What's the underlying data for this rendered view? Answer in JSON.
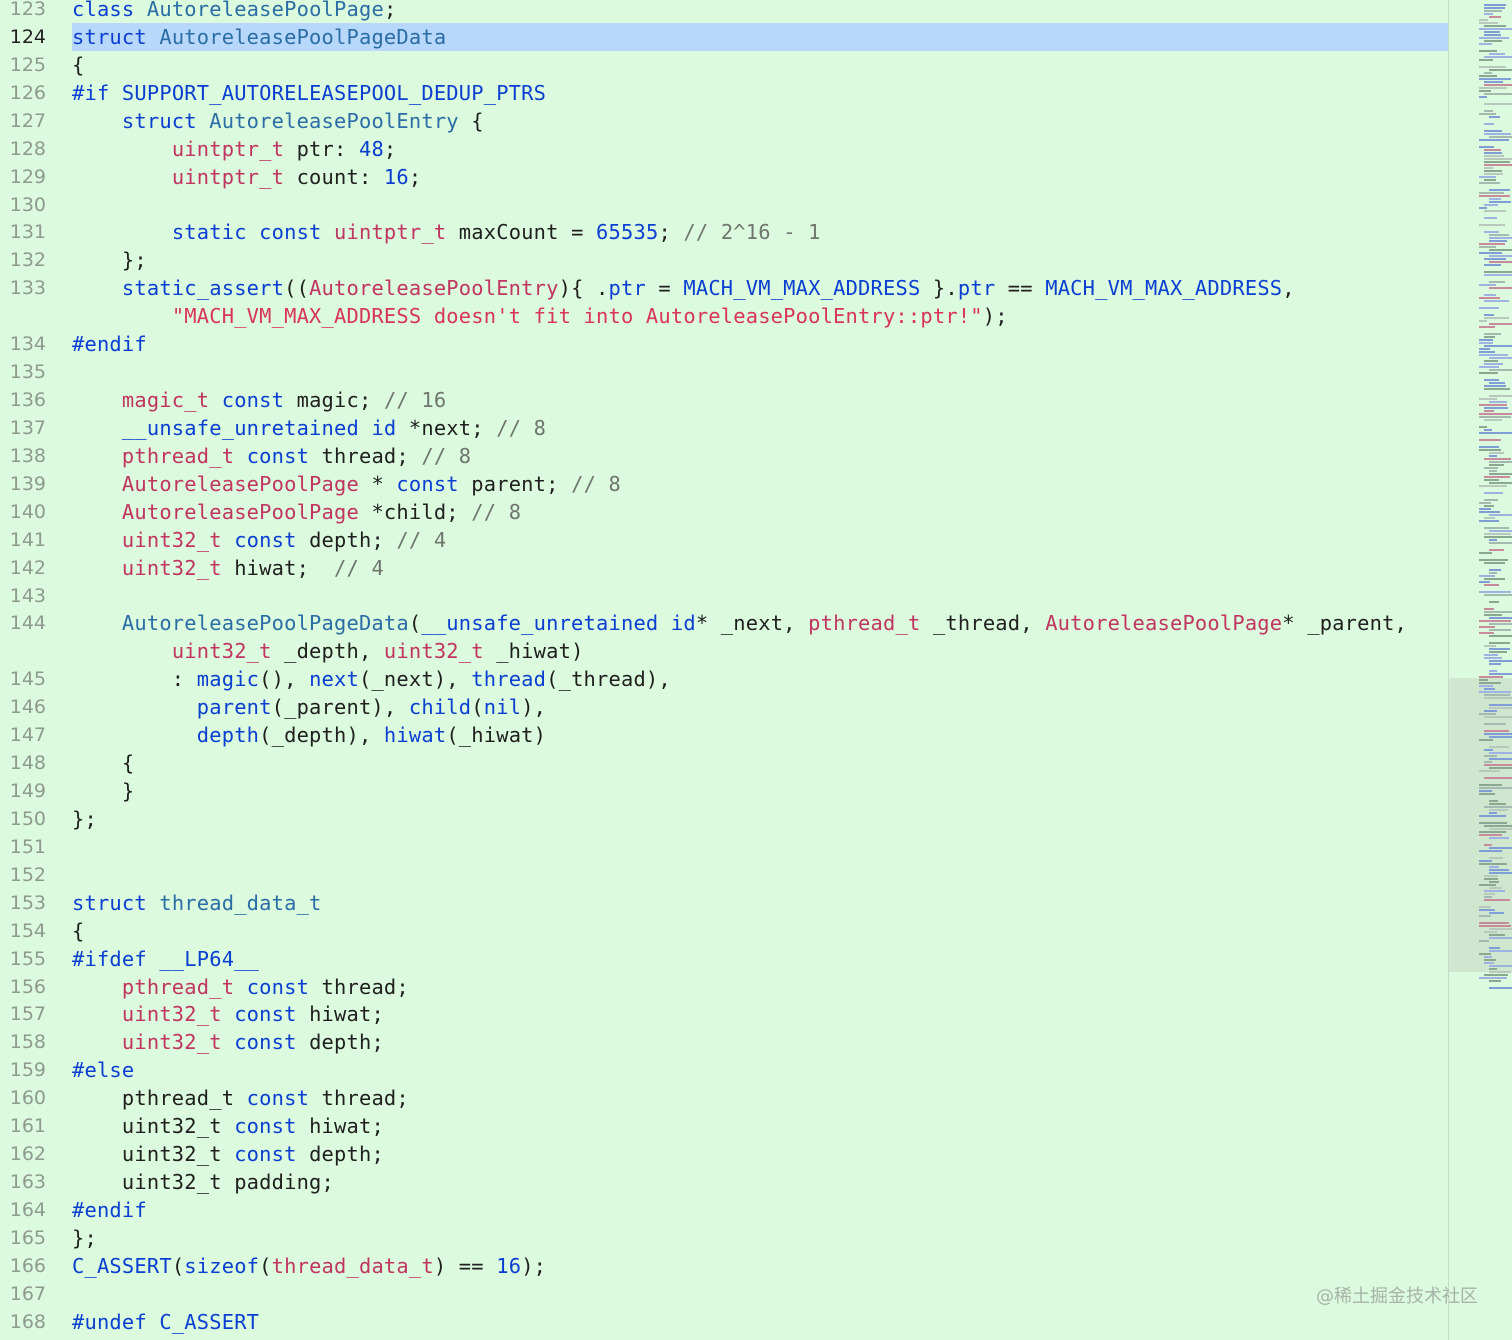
{
  "editor": {
    "current_line": 124,
    "lines": [
      {
        "num": "123",
        "tokens": [
          [
            "keyword",
            "class"
          ],
          [
            "plain",
            " "
          ],
          [
            "class",
            "AutoreleasePoolPage"
          ],
          [
            "plain",
            ";"
          ]
        ]
      },
      {
        "num": "124",
        "tokens": [
          [
            "keyword",
            "struct"
          ],
          [
            "plain",
            " "
          ],
          [
            "class",
            "AutoreleasePoolPageData"
          ]
        ]
      },
      {
        "num": "125",
        "tokens": [
          [
            "plain",
            "{"
          ]
        ]
      },
      {
        "num": "126",
        "tokens": [
          [
            "preproc",
            "#if"
          ],
          [
            "plain",
            " "
          ],
          [
            "macro",
            "SUPPORT_AUTORELEASEPOOL_DEDUP_PTRS"
          ]
        ]
      },
      {
        "num": "127",
        "tokens": [
          [
            "plain",
            "    "
          ],
          [
            "keyword",
            "struct"
          ],
          [
            "plain",
            " "
          ],
          [
            "class",
            "AutoreleasePoolEntry"
          ],
          [
            "plain",
            " {"
          ]
        ]
      },
      {
        "num": "128",
        "tokens": [
          [
            "plain",
            "        "
          ],
          [
            "type",
            "uintptr_t"
          ],
          [
            "plain",
            " ptr: "
          ],
          [
            "number",
            "48"
          ],
          [
            "plain",
            ";"
          ]
        ]
      },
      {
        "num": "129",
        "tokens": [
          [
            "plain",
            "        "
          ],
          [
            "type",
            "uintptr_t"
          ],
          [
            "plain",
            " count: "
          ],
          [
            "number",
            "16"
          ],
          [
            "plain",
            ";"
          ]
        ]
      },
      {
        "num": "130",
        "tokens": []
      },
      {
        "num": "131",
        "tokens": [
          [
            "plain",
            "        "
          ],
          [
            "keyword",
            "static"
          ],
          [
            "plain",
            " "
          ],
          [
            "keyword",
            "const"
          ],
          [
            "plain",
            " "
          ],
          [
            "type",
            "uintptr_t"
          ],
          [
            "plain",
            " maxCount = "
          ],
          [
            "number",
            "65535"
          ],
          [
            "plain",
            "; "
          ],
          [
            "comment",
            "// 2^16 - 1"
          ]
        ]
      },
      {
        "num": "132",
        "tokens": [
          [
            "plain",
            "    };"
          ]
        ]
      },
      {
        "num": "133",
        "tokens": [
          [
            "plain",
            "    "
          ],
          [
            "func",
            "static_assert"
          ],
          [
            "plain",
            "(("
          ],
          [
            "type",
            "AutoreleasePoolEntry"
          ],
          [
            "plain",
            "){ ."
          ],
          [
            "func",
            "ptr"
          ],
          [
            "plain",
            " = "
          ],
          [
            "macro",
            "MACH_VM_MAX_ADDRESS"
          ],
          [
            "plain",
            " }."
          ],
          [
            "func",
            "ptr"
          ],
          [
            "plain",
            " == "
          ],
          [
            "macro",
            "MACH_VM_MAX_ADDRESS"
          ],
          [
            "plain",
            ","
          ]
        ]
      },
      {
        "num": "",
        "tokens": [
          [
            "plain",
            "        "
          ],
          [
            "string",
            "\"MACH_VM_MAX_ADDRESS doesn't fit into AutoreleasePoolEntry::ptr!\""
          ],
          [
            "plain",
            ");"
          ]
        ]
      },
      {
        "num": "134",
        "tokens": [
          [
            "preproc",
            "#endif"
          ]
        ]
      },
      {
        "num": "135",
        "tokens": []
      },
      {
        "num": "136",
        "tokens": [
          [
            "plain",
            "    "
          ],
          [
            "type",
            "magic_t"
          ],
          [
            "plain",
            " "
          ],
          [
            "keyword",
            "const"
          ],
          [
            "plain",
            " magic; "
          ],
          [
            "comment",
            "// 16"
          ]
        ]
      },
      {
        "num": "137",
        "tokens": [
          [
            "plain",
            "    "
          ],
          [
            "keyword",
            "__unsafe_unretained"
          ],
          [
            "plain",
            " "
          ],
          [
            "keyword",
            "id"
          ],
          [
            "plain",
            " *next; "
          ],
          [
            "comment",
            "// 8"
          ]
        ]
      },
      {
        "num": "138",
        "tokens": [
          [
            "plain",
            "    "
          ],
          [
            "type",
            "pthread_t"
          ],
          [
            "plain",
            " "
          ],
          [
            "keyword",
            "const"
          ],
          [
            "plain",
            " thread; "
          ],
          [
            "comment",
            "// 8"
          ]
        ]
      },
      {
        "num": "139",
        "tokens": [
          [
            "plain",
            "    "
          ],
          [
            "type",
            "AutoreleasePoolPage"
          ],
          [
            "plain",
            " * "
          ],
          [
            "keyword",
            "const"
          ],
          [
            "plain",
            " parent; "
          ],
          [
            "comment",
            "// 8"
          ]
        ]
      },
      {
        "num": "140",
        "tokens": [
          [
            "plain",
            "    "
          ],
          [
            "type",
            "AutoreleasePoolPage"
          ],
          [
            "plain",
            " *child; "
          ],
          [
            "comment",
            "// 8"
          ]
        ]
      },
      {
        "num": "141",
        "tokens": [
          [
            "plain",
            "    "
          ],
          [
            "type",
            "uint32_t"
          ],
          [
            "plain",
            " "
          ],
          [
            "keyword",
            "const"
          ],
          [
            "plain",
            " depth; "
          ],
          [
            "comment",
            "// 4"
          ]
        ]
      },
      {
        "num": "142",
        "tokens": [
          [
            "plain",
            "    "
          ],
          [
            "type",
            "uint32_t"
          ],
          [
            "plain",
            " hiwat;  "
          ],
          [
            "comment",
            "// 4"
          ]
        ]
      },
      {
        "num": "143",
        "tokens": []
      },
      {
        "num": "144",
        "tokens": [
          [
            "plain",
            "    "
          ],
          [
            "class",
            "AutoreleasePoolPageData"
          ],
          [
            "plain",
            "("
          ],
          [
            "keyword",
            "__unsafe_unretained"
          ],
          [
            "plain",
            " "
          ],
          [
            "keyword",
            "id"
          ],
          [
            "plain",
            "* _next, "
          ],
          [
            "type",
            "pthread_t"
          ],
          [
            "plain",
            " _thread, "
          ],
          [
            "type",
            "AutoreleasePoolPage"
          ],
          [
            "plain",
            "* _parent,"
          ]
        ]
      },
      {
        "num": "",
        "tokens": [
          [
            "plain",
            "        "
          ],
          [
            "type",
            "uint32_t"
          ],
          [
            "plain",
            " _depth, "
          ],
          [
            "type",
            "uint32_t"
          ],
          [
            "plain",
            " _hiwat)"
          ]
        ]
      },
      {
        "num": "145",
        "tokens": [
          [
            "plain",
            "        : "
          ],
          [
            "func",
            "magic"
          ],
          [
            "plain",
            "(), "
          ],
          [
            "func",
            "next"
          ],
          [
            "plain",
            "(_next), "
          ],
          [
            "func",
            "thread"
          ],
          [
            "plain",
            "(_thread),"
          ]
        ]
      },
      {
        "num": "146",
        "tokens": [
          [
            "plain",
            "          "
          ],
          [
            "func",
            "parent"
          ],
          [
            "plain",
            "(_parent), "
          ],
          [
            "func",
            "child"
          ],
          [
            "plain",
            "("
          ],
          [
            "keyword",
            "nil"
          ],
          [
            "plain",
            "),"
          ]
        ]
      },
      {
        "num": "147",
        "tokens": [
          [
            "plain",
            "          "
          ],
          [
            "func",
            "depth"
          ],
          [
            "plain",
            "(_depth), "
          ],
          [
            "func",
            "hiwat"
          ],
          [
            "plain",
            "(_hiwat)"
          ]
        ]
      },
      {
        "num": "148",
        "tokens": [
          [
            "plain",
            "    {"
          ]
        ]
      },
      {
        "num": "149",
        "tokens": [
          [
            "plain",
            "    }"
          ]
        ]
      },
      {
        "num": "150",
        "tokens": [
          [
            "plain",
            "};"
          ]
        ]
      },
      {
        "num": "151",
        "tokens": []
      },
      {
        "num": "152",
        "tokens": []
      },
      {
        "num": "153",
        "tokens": [
          [
            "keyword",
            "struct"
          ],
          [
            "plain",
            " "
          ],
          [
            "class",
            "thread_data_t"
          ]
        ]
      },
      {
        "num": "154",
        "tokens": [
          [
            "plain",
            "{"
          ]
        ]
      },
      {
        "num": "155",
        "tokens": [
          [
            "preproc",
            "#ifdef"
          ],
          [
            "plain",
            " "
          ],
          [
            "macro",
            "__LP64__"
          ]
        ]
      },
      {
        "num": "156",
        "tokens": [
          [
            "plain",
            "    "
          ],
          [
            "type",
            "pthread_t"
          ],
          [
            "plain",
            " "
          ],
          [
            "keyword",
            "const"
          ],
          [
            "plain",
            " thread;"
          ]
        ]
      },
      {
        "num": "157",
        "tokens": [
          [
            "plain",
            "    "
          ],
          [
            "type",
            "uint32_t"
          ],
          [
            "plain",
            " "
          ],
          [
            "keyword",
            "const"
          ],
          [
            "plain",
            " hiwat;"
          ]
        ]
      },
      {
        "num": "158",
        "tokens": [
          [
            "plain",
            "    "
          ],
          [
            "type",
            "uint32_t"
          ],
          [
            "plain",
            " "
          ],
          [
            "keyword",
            "const"
          ],
          [
            "plain",
            " depth;"
          ]
        ]
      },
      {
        "num": "159",
        "tokens": [
          [
            "preproc",
            "#else"
          ]
        ]
      },
      {
        "num": "160",
        "tokens": [
          [
            "plain",
            "    pthread_t "
          ],
          [
            "keyword",
            "const"
          ],
          [
            "plain",
            " thread;"
          ]
        ]
      },
      {
        "num": "161",
        "tokens": [
          [
            "plain",
            "    uint32_t "
          ],
          [
            "keyword",
            "const"
          ],
          [
            "plain",
            " hiwat;"
          ]
        ]
      },
      {
        "num": "162",
        "tokens": [
          [
            "plain",
            "    uint32_t "
          ],
          [
            "keyword",
            "const"
          ],
          [
            "plain",
            " depth;"
          ]
        ]
      },
      {
        "num": "163",
        "tokens": [
          [
            "plain",
            "    uint32_t padding;"
          ]
        ]
      },
      {
        "num": "164",
        "tokens": [
          [
            "preproc",
            "#endif"
          ]
        ]
      },
      {
        "num": "165",
        "tokens": [
          [
            "plain",
            "};"
          ]
        ]
      },
      {
        "num": "166",
        "tokens": [
          [
            "macro",
            "C_ASSERT"
          ],
          [
            "plain",
            "("
          ],
          [
            "func",
            "sizeof"
          ],
          [
            "plain",
            "("
          ],
          [
            "type",
            "thread_data_t"
          ],
          [
            "plain",
            ") == "
          ],
          [
            "number",
            "16"
          ],
          [
            "plain",
            ");"
          ]
        ]
      },
      {
        "num": "167",
        "tokens": []
      },
      {
        "num": "168",
        "tokens": [
          [
            "preproc",
            "#undef"
          ],
          [
            "plain",
            " "
          ],
          [
            "macro",
            "C_ASSERT"
          ]
        ]
      }
    ]
  },
  "colors": {
    "background": "#dcfadd",
    "current_line_highlight": "#b7d7fb",
    "keyword": "#0b3fd1",
    "type": "#c03561",
    "class": "#2b6da5",
    "comment": "#6f766f",
    "string": "#d8355a"
  },
  "minimap": {
    "icon": "minimap-overview"
  },
  "watermark": {
    "text": "@稀土掘金技术社区"
  }
}
